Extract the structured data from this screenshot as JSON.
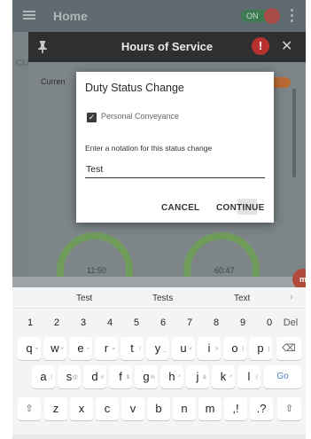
{
  "appbar": {
    "title": "Home",
    "toggle_label": "ON"
  },
  "hos": {
    "title": "Hours of Service",
    "current_label": "Curren",
    "left_edge_label": "CU",
    "gauges": [
      "11:50",
      "60:47"
    ],
    "fab_label": "m"
  },
  "dialog": {
    "title": "Duty Status Change",
    "checkbox_label": "Personal Conveyance",
    "checkbox_checked": true,
    "note_label": "Enter a notation for this status change",
    "note_value": "Test",
    "cancel_label": "CANCEL",
    "continue_label": "CONTINUE"
  },
  "keyboard": {
    "suggestions": [
      "Test",
      "Tests",
      "Text"
    ],
    "row_numbers": [
      "1",
      "2",
      "3",
      "4",
      "5",
      "6",
      "7",
      "8",
      "9",
      "0",
      "Del"
    ],
    "row1": [
      "q",
      "w",
      "e",
      "r",
      "t",
      "y",
      "u",
      "i",
      "o",
      "p"
    ],
    "row1_hints": [
      "+",
      "×",
      "÷",
      "=",
      "/",
      "_",
      "<",
      ">",
      "[",
      "]"
    ],
    "row2": [
      "a",
      "s",
      "d",
      "f",
      "g",
      "h",
      "j",
      "k",
      "l"
    ],
    "row2_hints": [
      "!",
      "@",
      "#",
      "$",
      "%",
      "^",
      "&",
      "*",
      "("
    ],
    "row3": [
      "z",
      "x",
      "c",
      "v",
      "b",
      "n",
      "m",
      ",!",
      ".?"
    ],
    "go_label": "Go",
    "backspace": "⌫",
    "shift": "⇧"
  }
}
